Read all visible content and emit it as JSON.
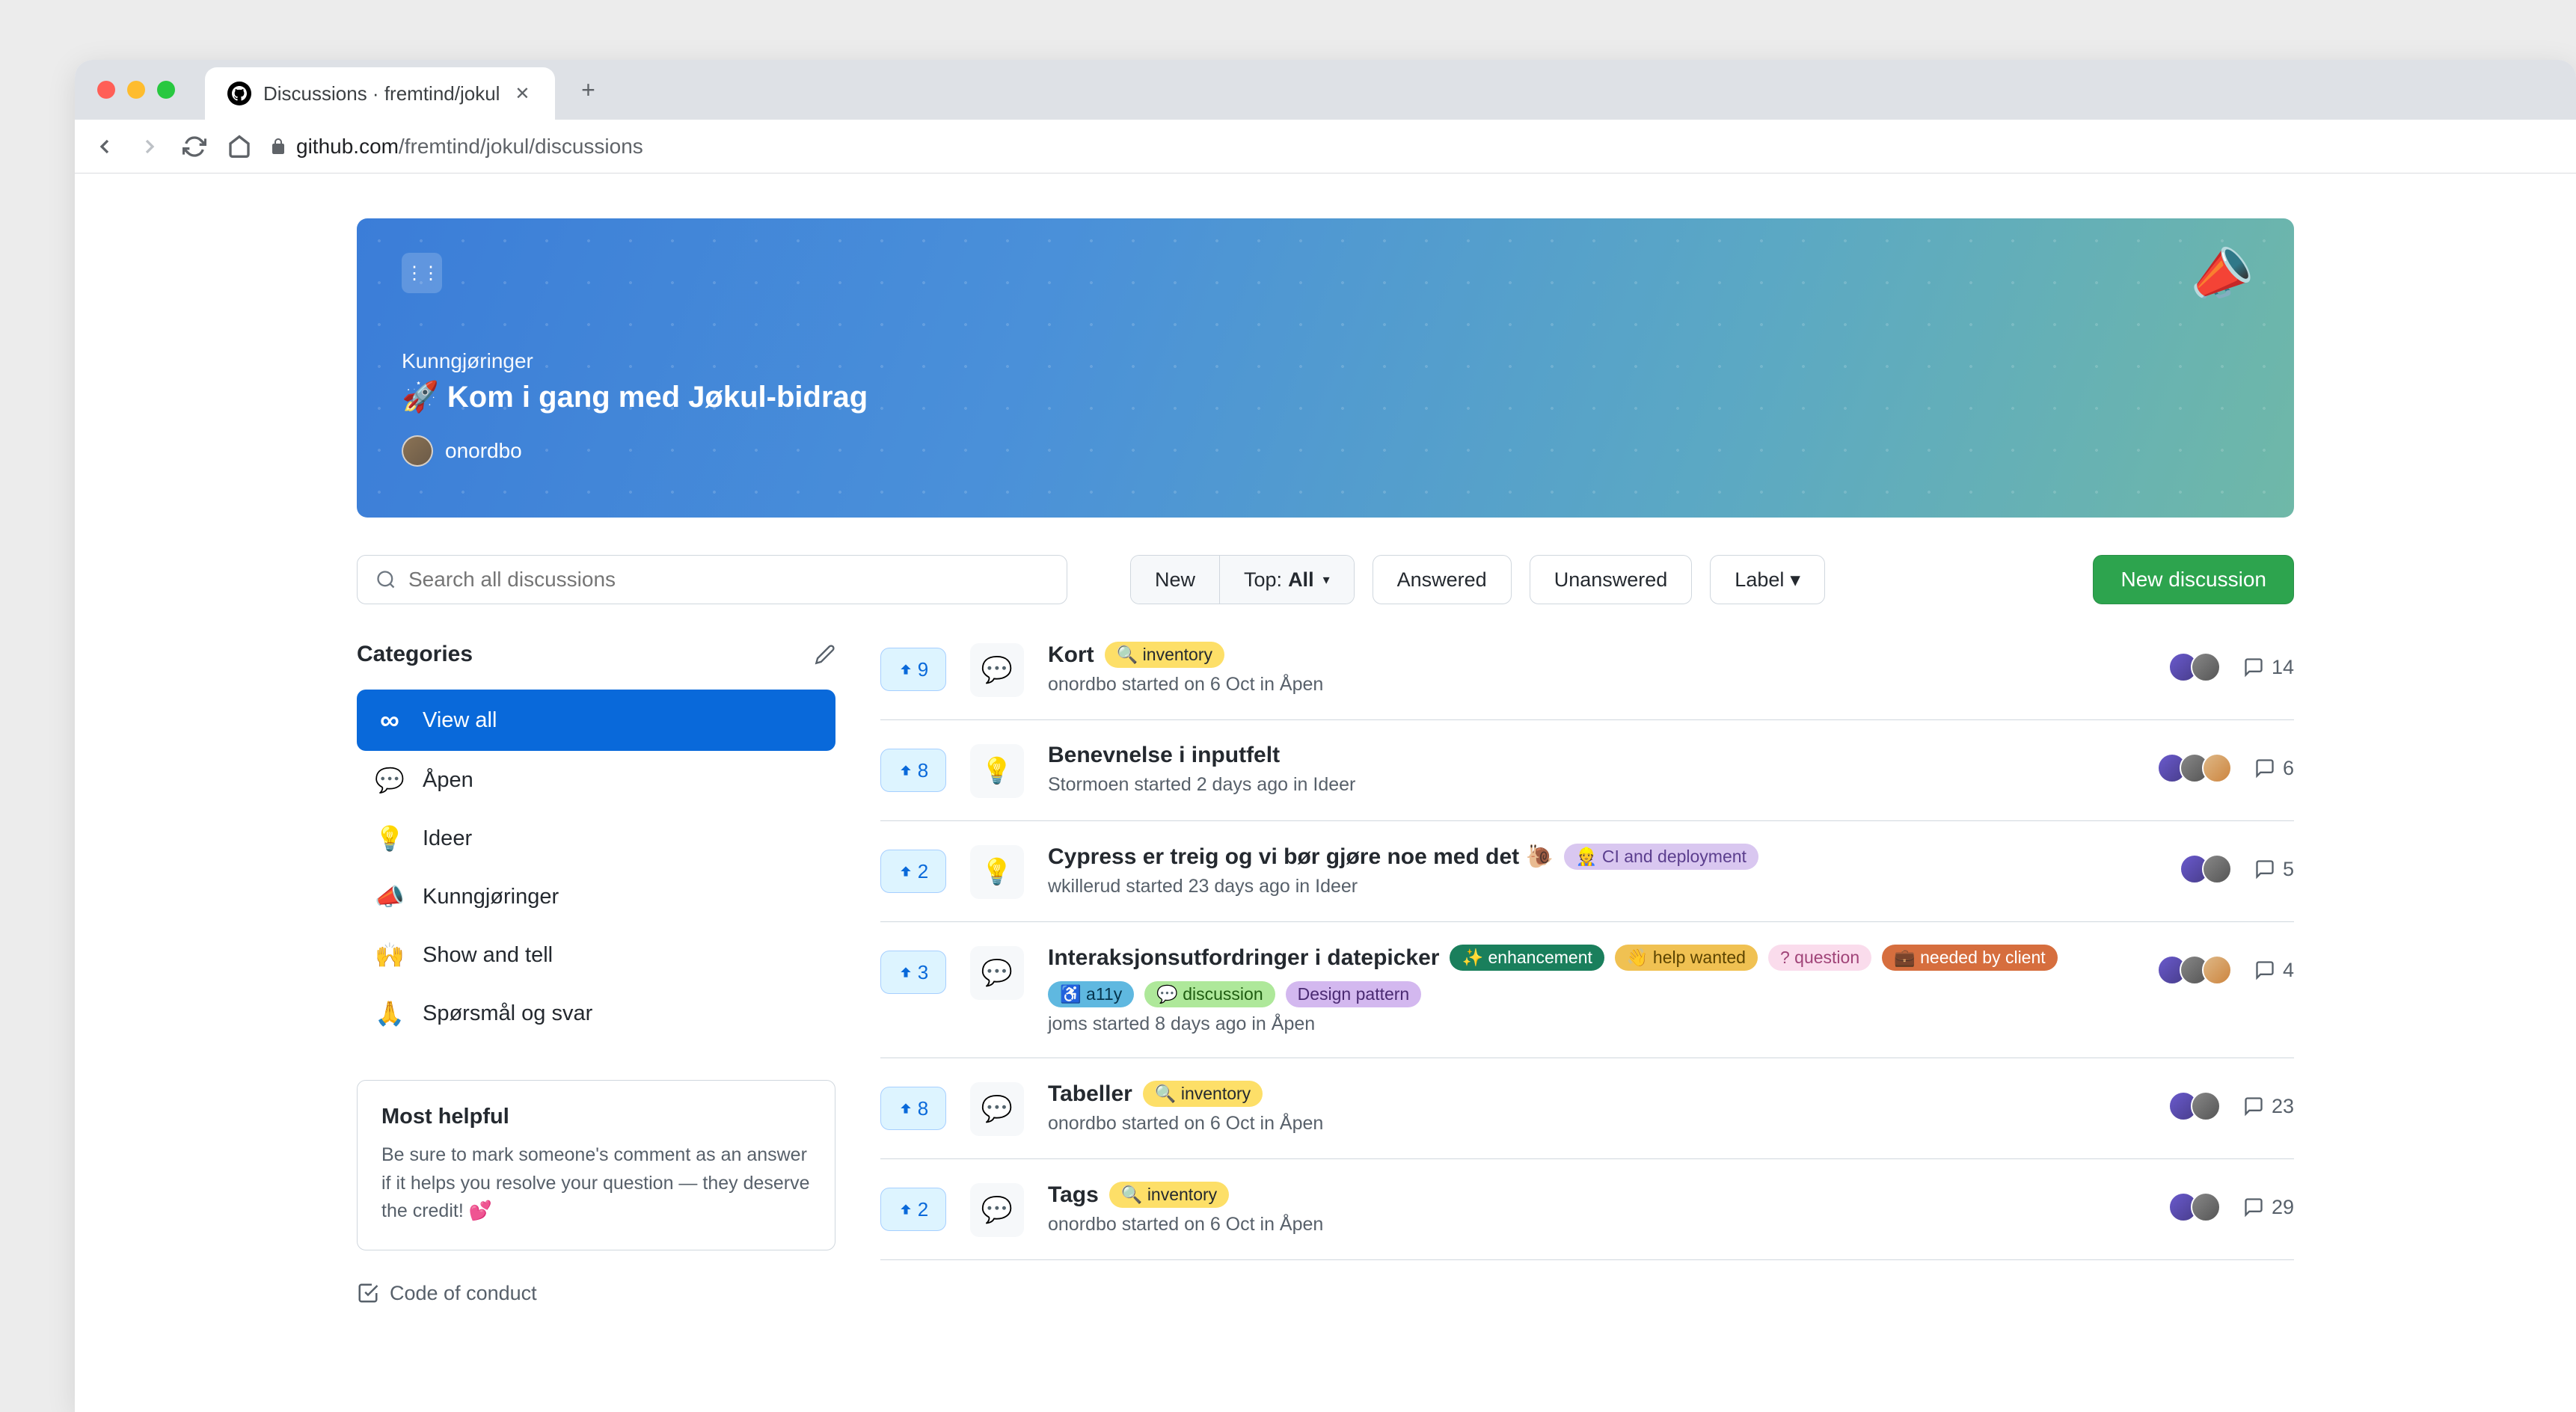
{
  "browser": {
    "tab_title": "Discussions · fremtind/jokul",
    "url_host": "github.com",
    "url_path": "/fremtind/jokul/discussions"
  },
  "banner": {
    "category": "Kunngjøringer",
    "title": "🚀 Kom i gang med Jøkul-bidrag",
    "author": "onordbo"
  },
  "search": {
    "placeholder": "Search all discussions"
  },
  "filters": {
    "new": "New",
    "top_prefix": "Top: ",
    "top_value": "All",
    "answered": "Answered",
    "unanswered": "Unanswered",
    "label": "Label"
  },
  "primary_button": "New discussion",
  "categories": {
    "heading": "Categories",
    "items": [
      {
        "icon": "∞",
        "label": "View all",
        "active": true
      },
      {
        "icon": "💬",
        "label": "Åpen"
      },
      {
        "icon": "💡",
        "label": "Ideer"
      },
      {
        "icon": "📣",
        "label": "Kunngjøringer"
      },
      {
        "icon": "🙌",
        "label": "Show and tell"
      },
      {
        "icon": "🙏",
        "label": "Spørsmål og svar"
      }
    ]
  },
  "helpful": {
    "heading": "Most helpful",
    "body": "Be sure to mark someone's comment as an answer if it helps you resolve your question — they deserve the credit! 💕"
  },
  "coc": "Code of conduct",
  "discussions": [
    {
      "votes": 9,
      "icon": "💬",
      "title": "Kort",
      "labels": [
        {
          "text": "🔍 inventory",
          "cls": "lbl-inv"
        }
      ],
      "meta": "onordbo started on 6 Oct in Åpen",
      "comments": 14,
      "avatars": 2
    },
    {
      "votes": 8,
      "icon": "💡",
      "title": "Benevnelse i inputfelt",
      "labels": [],
      "meta": "Stormoen started 2 days ago in Ideer",
      "comments": 6,
      "avatars": 3
    },
    {
      "votes": 2,
      "icon": "💡",
      "title": "Cypress er treig og vi bør gjøre noe med det 🐌",
      "labels": [
        {
          "text": "👷 CI and deployment",
          "cls": "lbl-ci"
        }
      ],
      "meta": "wkillerud started 23 days ago in Ideer",
      "comments": 5,
      "avatars": 2
    },
    {
      "votes": 3,
      "icon": "💬",
      "title": "Interaksjonsutfordringer i datepicker",
      "labels": [
        {
          "text": "✨ enhancement",
          "cls": "lbl-enh"
        },
        {
          "text": "👋 help wanted",
          "cls": "lbl-help"
        },
        {
          "text": "? question",
          "cls": "lbl-q"
        },
        {
          "text": "💼 needed by client",
          "cls": "lbl-need"
        },
        {
          "text": "♿ a11y",
          "cls": "lbl-a11y"
        },
        {
          "text": "💬 discussion",
          "cls": "lbl-disc"
        },
        {
          "text": "Design pattern",
          "cls": "lbl-dp"
        }
      ],
      "meta": "joms started 8 days ago in Åpen",
      "comments": 4,
      "avatars": 3
    },
    {
      "votes": 8,
      "icon": "💬",
      "title": "Tabeller",
      "labels": [
        {
          "text": "🔍 inventory",
          "cls": "lbl-inv"
        }
      ],
      "meta": "onordbo started on 6 Oct in Åpen",
      "comments": 23,
      "avatars": 2
    },
    {
      "votes": 2,
      "icon": "💬",
      "title": "Tags",
      "labels": [
        {
          "text": "🔍 inventory",
          "cls": "lbl-inv"
        }
      ],
      "meta": "onordbo started on 6 Oct in Åpen",
      "comments": 29,
      "avatars": 2
    }
  ]
}
